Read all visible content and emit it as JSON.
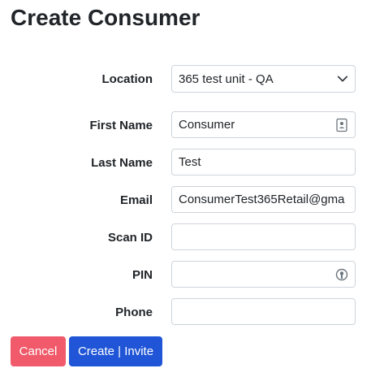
{
  "page": {
    "title": "Create Consumer"
  },
  "form": {
    "location": {
      "label": "Location",
      "value": "365 test unit - QA"
    },
    "first_name": {
      "label": "First Name",
      "value": "Consumer"
    },
    "last_name": {
      "label": "Last Name",
      "value": "Test"
    },
    "email": {
      "label": "Email",
      "value": "ConsumerTest365Retail@gma"
    },
    "scan_id": {
      "label": "Scan ID",
      "value": ""
    },
    "pin": {
      "label": "PIN",
      "value": ""
    },
    "phone": {
      "label": "Phone",
      "value": ""
    }
  },
  "buttons": {
    "cancel_label": "Cancel",
    "create_label": "Create | Invite"
  },
  "icons": {
    "location_chevron": "chevron-down-icon",
    "first_name_icon": "contact-card-icon",
    "pin_icon": "password-manager-icon"
  },
  "colors": {
    "cancel": "#f05a6a",
    "create": "#1f55d6",
    "border": "#ced4da"
  }
}
